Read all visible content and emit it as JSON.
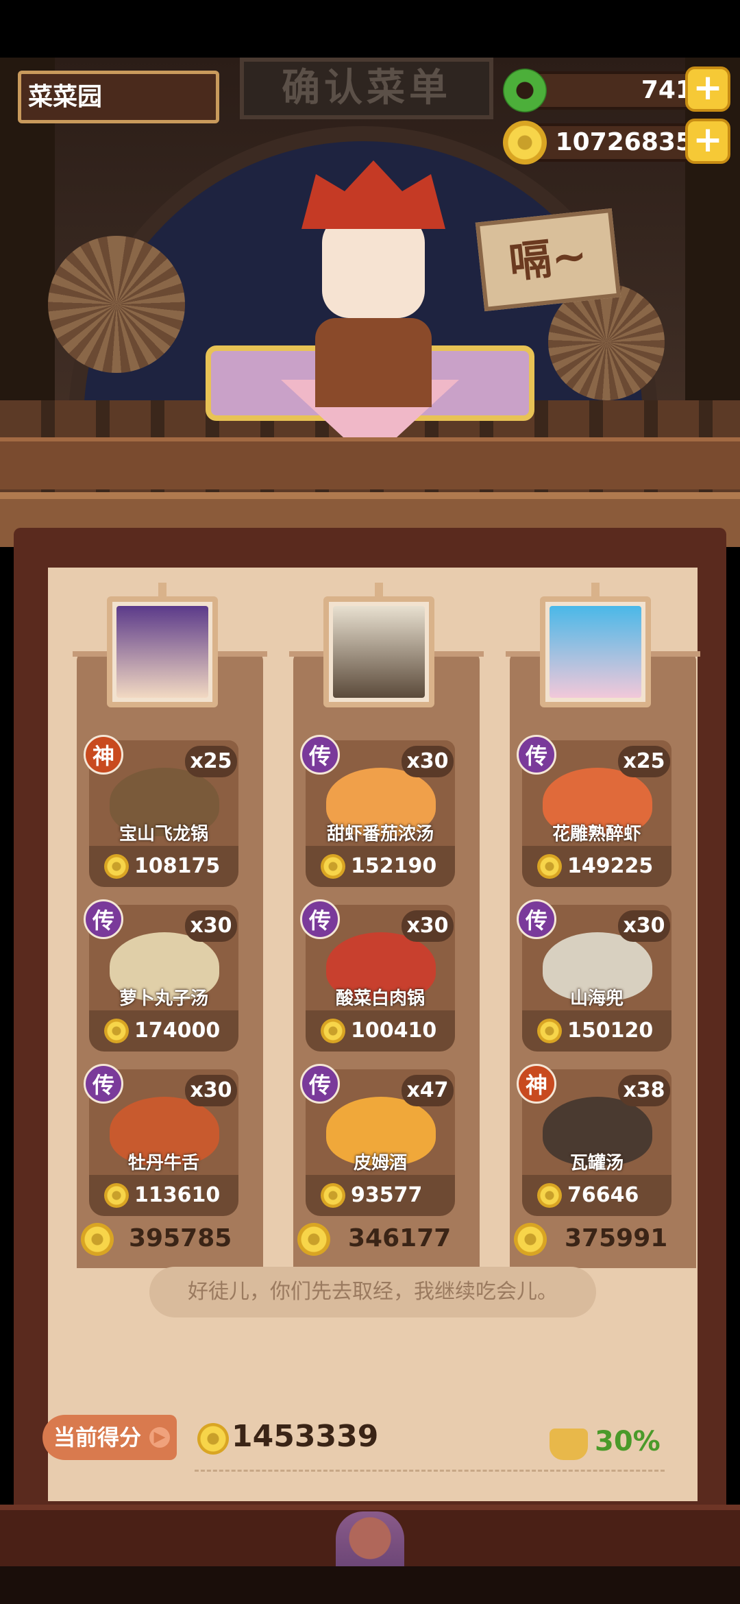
{
  "hud": {
    "shop_name": "菜菜园",
    "jade": "741",
    "coins": "10726835",
    "plus": "+"
  },
  "scene": {
    "sign": "确认菜单",
    "speech": "嗝~"
  },
  "columns": [
    {
      "dishes": [
        {
          "rarity": "神",
          "qty": "x25",
          "name": "宝山飞龙锅",
          "price": "108175",
          "color": "#7a5a3a"
        },
        {
          "rarity": "传",
          "qty": "x30",
          "name": "萝卜丸子汤",
          "price": "174000",
          "color": "#e0cfa8"
        },
        {
          "rarity": "传",
          "qty": "x30",
          "name": "牡丹牛舌",
          "price": "113610",
          "color": "#c85a2e"
        }
      ],
      "total": "395785"
    },
    {
      "dishes": [
        {
          "rarity": "传",
          "qty": "x30",
          "name": "甜虾番茄浓汤",
          "price": "152190",
          "color": "#f0a04a"
        },
        {
          "rarity": "传",
          "qty": "x30",
          "name": "酸菜白肉锅",
          "price": "100410",
          "color": "#c8402e"
        },
        {
          "rarity": "传",
          "qty": "x47",
          "name": "皮姆酒",
          "price": "93577",
          "color": "#f0a83a"
        }
      ],
      "total": "346177"
    },
    {
      "dishes": [
        {
          "rarity": "传",
          "qty": "x25",
          "name": "花雕熟醉虾",
          "price": "149225",
          "color": "#e06a3a"
        },
        {
          "rarity": "传",
          "qty": "x30",
          "name": "山海兜",
          "price": "150120",
          "color": "#d8d0c0"
        },
        {
          "rarity": "神",
          "qty": "x38",
          "name": "瓦罐汤",
          "price": "76646",
          "color": "#4a3a30"
        }
      ],
      "total": "375991"
    }
  ],
  "quote": "好徒儿，你们先去取经，我继续吃会儿。",
  "score": {
    "label": "当前得分",
    "value": "1453339",
    "bonus": "30%"
  }
}
